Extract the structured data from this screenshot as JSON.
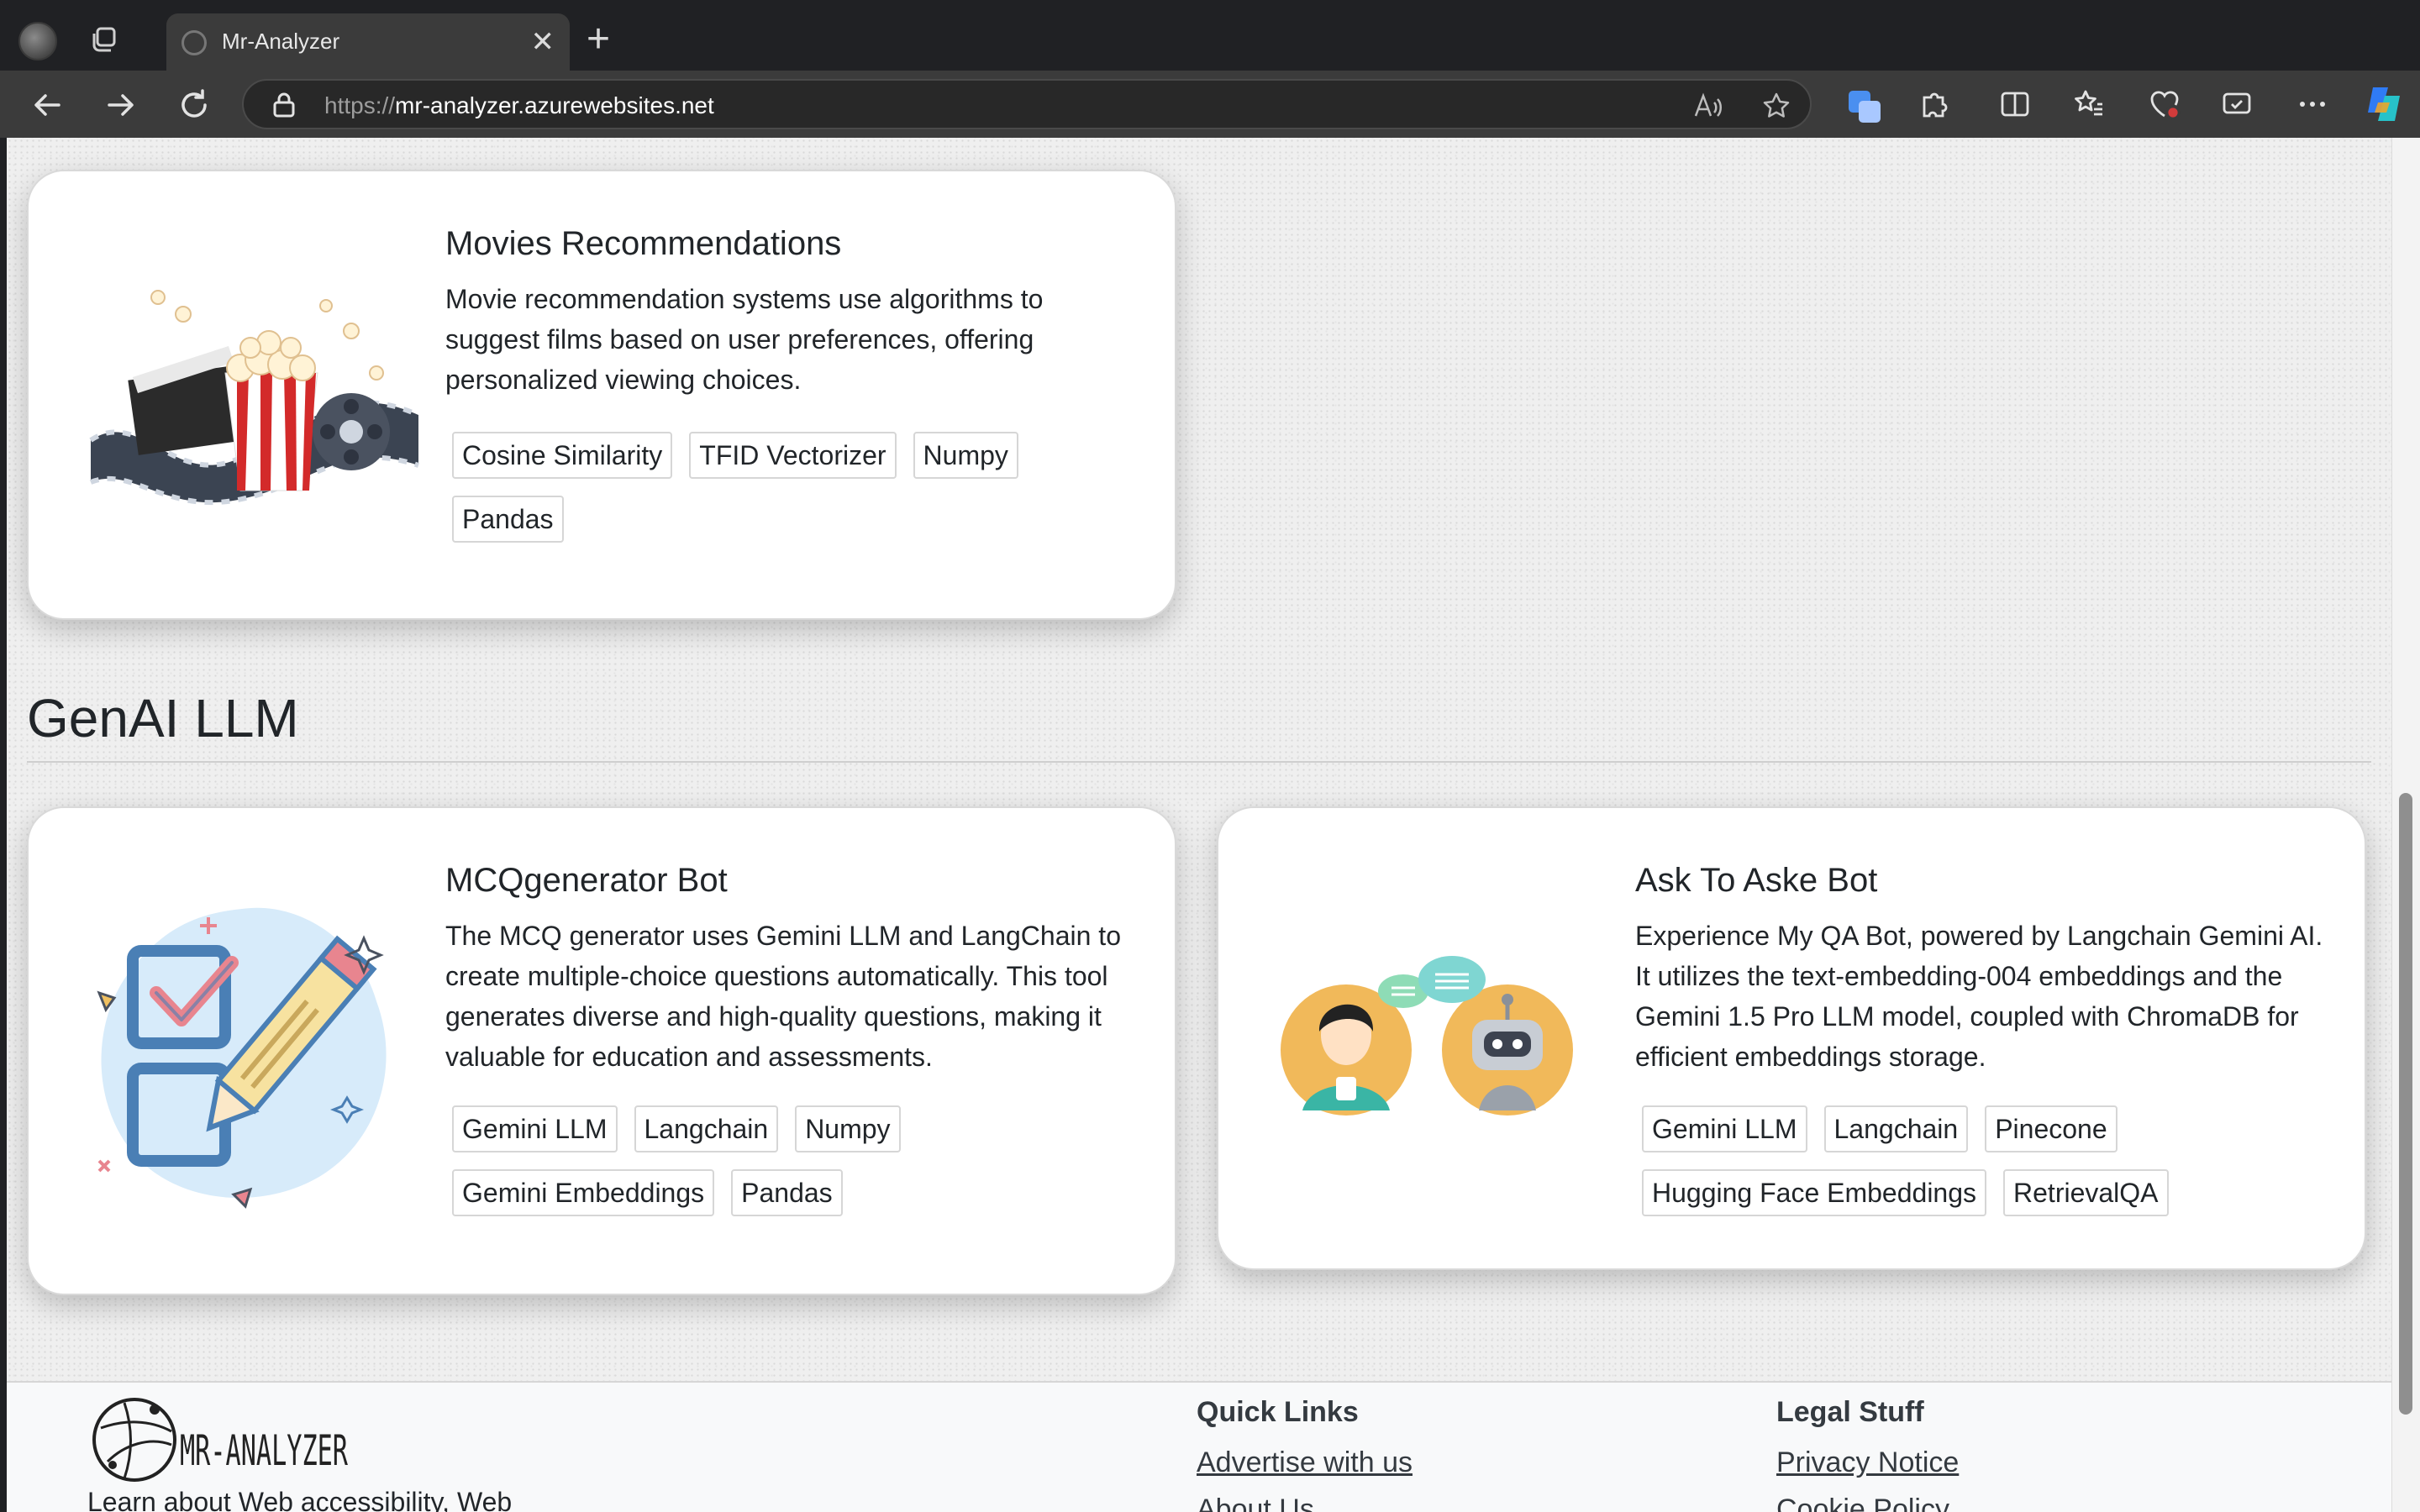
{
  "browser": {
    "tab_title": "Mr-Analyzer",
    "url_scheme": "https://",
    "url_host": "mr-analyzer.azurewebsites.net"
  },
  "cards": [
    {
      "title": "Movies Recommendations",
      "description": "Movie recommendation systems use algorithms to suggest films based on user preferences, offering personalized viewing choices.",
      "tags": [
        "Cosine Similarity",
        "TFID Vectorizer",
        "Numpy",
        "Pandas"
      ],
      "image": "movie-reel-popcorn-illustration"
    }
  ],
  "section": {
    "title": "GenAI LLM"
  },
  "genai_cards": [
    {
      "title": "MCQgenerator Bot",
      "description": "The MCQ generator uses Gemini LLM and LangChain to create multiple-choice questions automatically. This tool generates diverse and high-quality questions, making it valuable for education and assessments.",
      "tags": [
        "Gemini LLM",
        "Langchain",
        "Numpy",
        "Gemini Embeddings",
        "Pandas"
      ],
      "image": "checklist-pencil-illustration"
    },
    {
      "title": "Ask To Aske Bot",
      "description": "Experience My QA Bot, powered by Langchain Gemini AI. It utilizes the text-embedding-004 embeddings and the Gemini 1.5 Pro LLM model, coupled with ChromaDB for efficient embeddings storage.",
      "tags": [
        "Gemini LLM",
        "Langchain",
        "Pinecone",
        "Hugging Face Embeddings",
        "RetrievalQA"
      ],
      "image": "person-robot-chat-illustration"
    }
  ],
  "footer": {
    "logo_text": "MR-ANALYZER",
    "about_text": "Learn about Web accessibility, Web",
    "quick_links_heading": "Quick Links",
    "quick_links": [
      "Advertise with us",
      "About Us"
    ],
    "legal_heading": "Legal Stuff",
    "legal_links": [
      "Privacy Notice",
      "Cookie Policy"
    ]
  }
}
